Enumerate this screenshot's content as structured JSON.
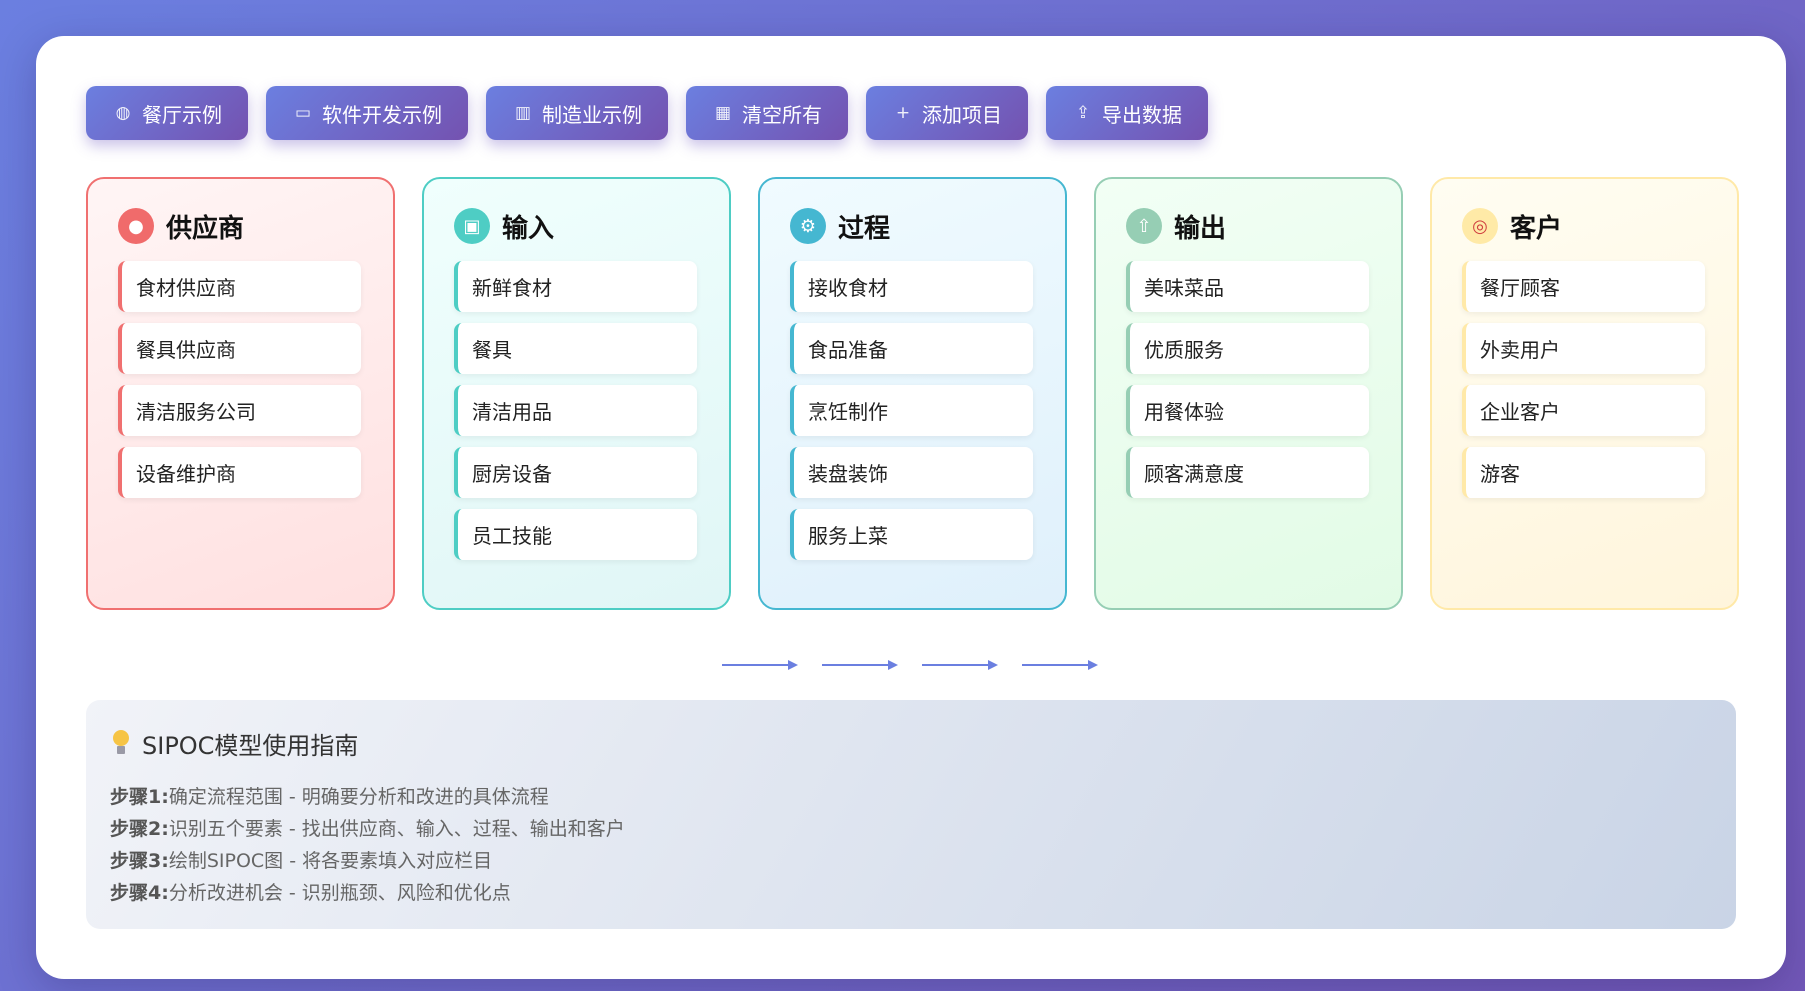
{
  "toolbar": {
    "buttons": [
      {
        "icon": "plate-icon",
        "glyph": "◍",
        "label": "餐厅示例"
      },
      {
        "icon": "laptop-icon",
        "glyph": "▭",
        "label": "软件开发示例"
      },
      {
        "icon": "factory-icon",
        "glyph": "▥",
        "label": "制造业示例"
      },
      {
        "icon": "trash-icon",
        "glyph": "▦",
        "label": "清空所有"
      },
      {
        "icon": "plus-icon",
        "glyph": "+",
        "label": "添加项目"
      },
      {
        "icon": "export-icon",
        "glyph": "⇪",
        "label": "导出数据"
      }
    ]
  },
  "columns": [
    {
      "key": "suppliers",
      "icon": "people-icon",
      "glyph": "●",
      "title": "供应商",
      "items": [
        "食材供应商",
        "餐具供应商",
        "清洁服务公司",
        "设备维护商"
      ]
    },
    {
      "key": "inputs",
      "icon": "box-icon",
      "glyph": "▣",
      "title": "输入",
      "items": [
        "新鲜食材",
        "餐具",
        "清洁用品",
        "厨房设备",
        "员工技能"
      ]
    },
    {
      "key": "process",
      "icon": "gear-icon",
      "glyph": "⚙",
      "title": "过程",
      "items": [
        "接收食材",
        "食品准备",
        "烹饪制作",
        "装盘装饰",
        "服务上菜"
      ]
    },
    {
      "key": "outputs",
      "icon": "outbox-icon",
      "glyph": "⇧",
      "title": "输出",
      "items": [
        "美味菜品",
        "优质服务",
        "用餐体验",
        "顾客满意度"
      ]
    },
    {
      "key": "customers",
      "icon": "target-icon",
      "glyph": "◎",
      "title": "客户",
      "items": [
        "餐厅顾客",
        "外卖用户",
        "企业客户",
        "游客"
      ]
    }
  ],
  "colors": {
    "suppliers": "#f07070",
    "inputs": "#4ecdc4",
    "process": "#45b7d1",
    "outputs": "#96ceb4",
    "customers": "#ffe9a8",
    "arrow": "#6b7fe0"
  },
  "guide": {
    "icon": "lightbulb-icon",
    "title": "SIPOC模型使用指南",
    "steps": [
      {
        "label": "步骤1:",
        "text": "确定流程范围 - 明确要分析和改进的具体流程"
      },
      {
        "label": "步骤2:",
        "text": "识别五个要素 - 找出供应商、输入、过程、输出和客户"
      },
      {
        "label": "步骤3:",
        "text": "绘制SIPOC图 - 将各要素填入对应栏目"
      },
      {
        "label": "步骤4:",
        "text": "分析改进机会 - 识别瓶颈、风险和优化点"
      }
    ]
  }
}
